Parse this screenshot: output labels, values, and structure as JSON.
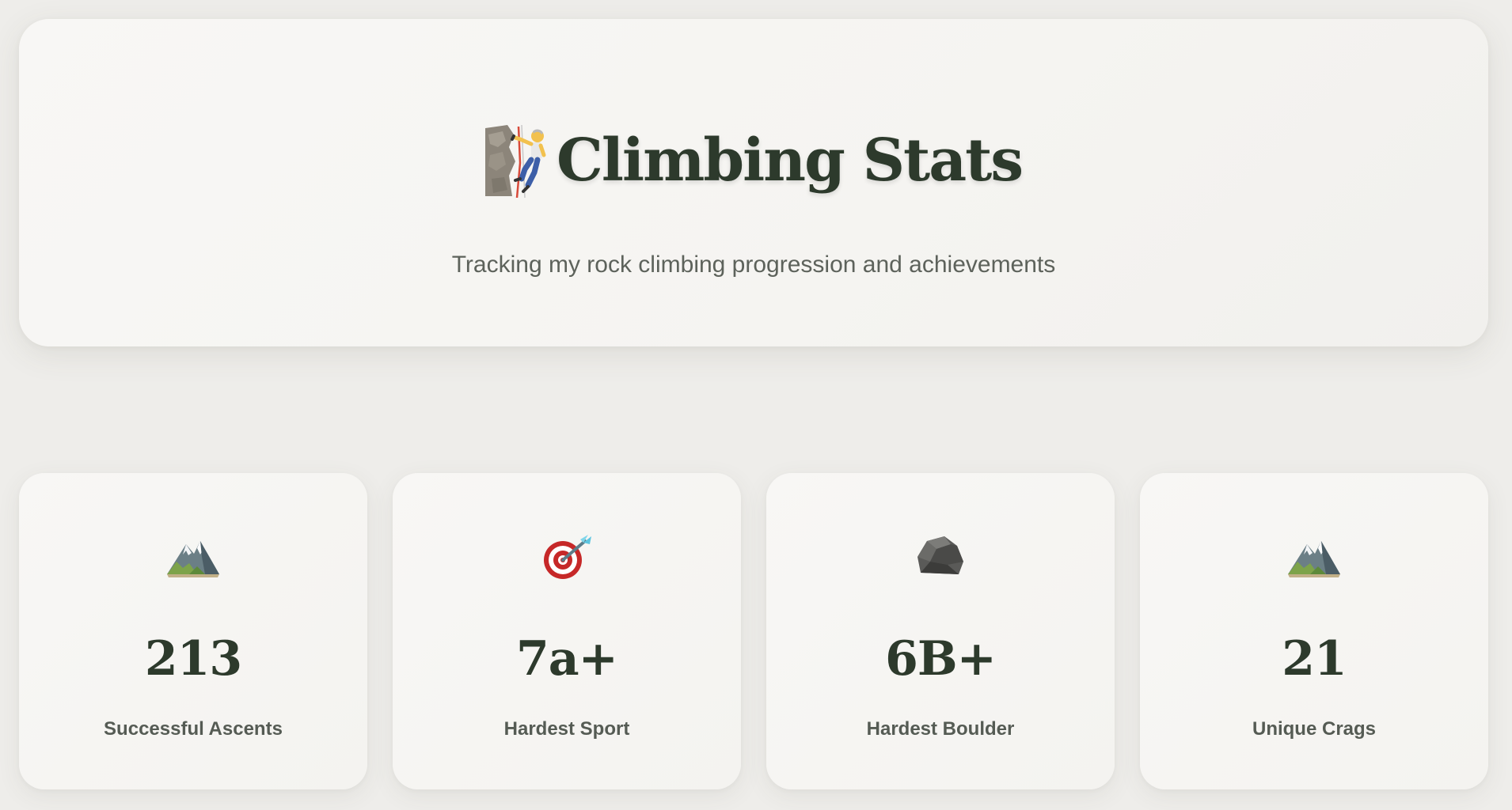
{
  "hero": {
    "icon": "rock-climber-icon",
    "title": "Climbing Stats",
    "subtitle": "Tracking my rock climbing progression and achievements"
  },
  "stats": [
    {
      "icon": "mountain-icon",
      "value": "213",
      "label": "Successful Ascents"
    },
    {
      "icon": "target-icon",
      "value": "7a+",
      "label": "Hardest Sport"
    },
    {
      "icon": "rock-icon",
      "value": "6B+",
      "label": "Hardest Boulder"
    },
    {
      "icon": "mountain-icon",
      "value": "21",
      "label": "Unique Crags"
    }
  ],
  "colors": {
    "background": "#eeedea",
    "card": "#f7f6f4",
    "heading": "#2d3a2c",
    "subtext": "#5d625b",
    "label": "#555b54"
  }
}
